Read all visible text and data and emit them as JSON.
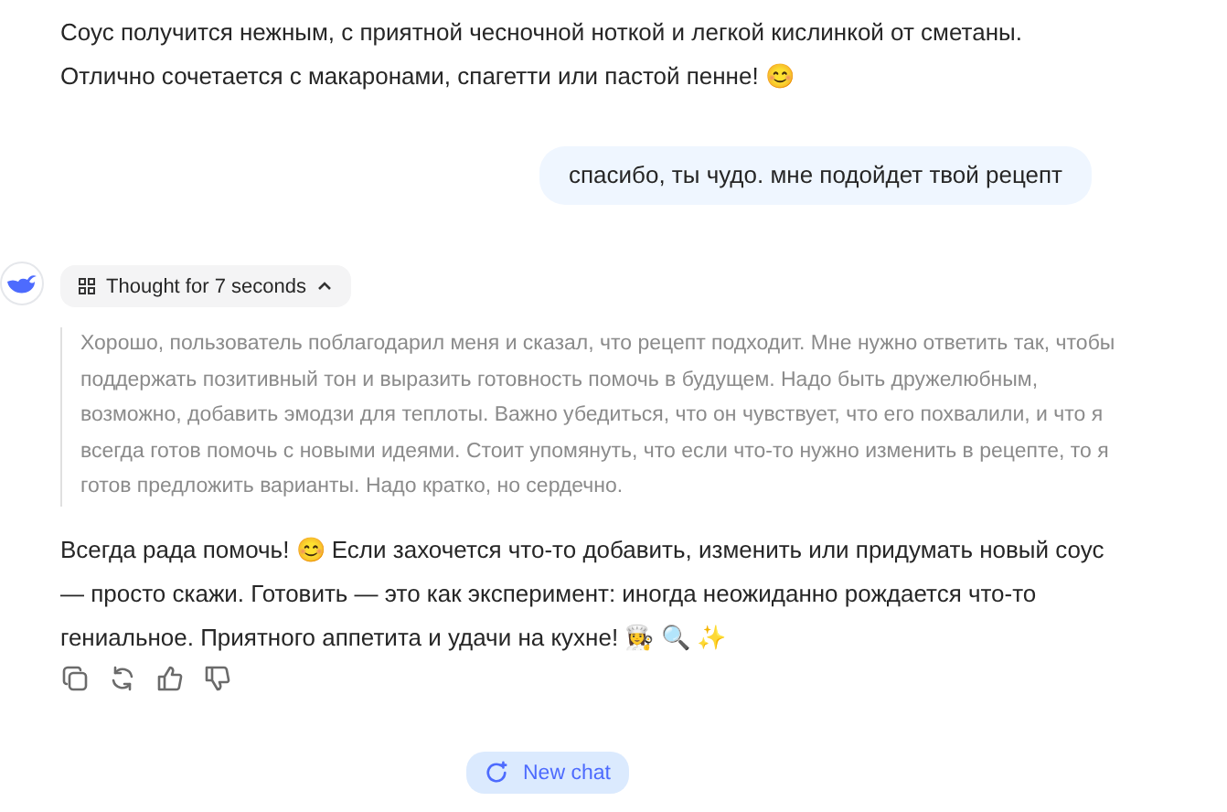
{
  "messages": [
    {
      "kind": "assistant",
      "text": "Соус получится нежным, с приятной чесночной ноткой и легкой кислинкой от сметаны. Отлично сочетается с макаронами, спагетти или пастой пенне! 😊"
    },
    {
      "kind": "user",
      "text": "спасибо, ты чудо. мне подойдет твой рецепт"
    },
    {
      "kind": "assistant_thought",
      "thought_label": "Thought for 7 seconds",
      "expanded": true,
      "thought": "Хорошо, пользователь поблагодарил меня и сказал, что рецепт подходит. Мне нужно ответить так, чтобы поддержать позитивный тон и выразить готовность помочь в будущем. Надо быть дружелюбным, возможно, добавить эмодзи для теплоты. Важно убедиться, что он чувствует, что его похвалили, и что я всегда готов помочь с новыми идеями. Стоит упомянуть, что если что-то нужно изменить в рецепте, то я готов предложить варианты. Надо кратко, но сердечно.",
      "text": "Всегда рада помочь! 😊 Если захочется что-то добавить, изменить или придумать новый соус — просто скажи. Готовить — это как эксперимент: иногда неожиданно рождается что-то гениальное. Приятного аппетита и удачи на кухне! 👩‍🍳 🔍 ✨"
    }
  ],
  "new_chat": {
    "label": "New chat"
  }
}
